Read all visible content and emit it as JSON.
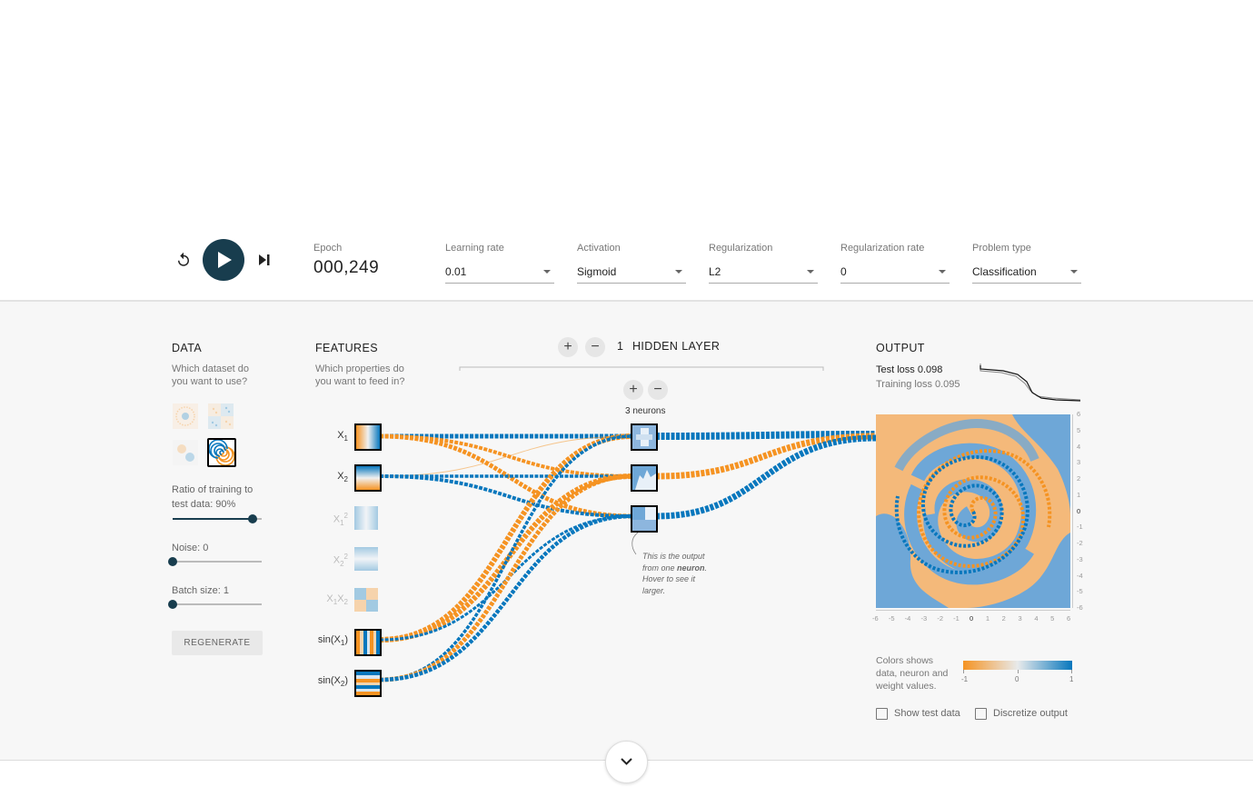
{
  "controls": {
    "reset_icon": "reset-icon",
    "play_icon": "play-icon",
    "step_icon": "step-icon",
    "epoch_label": "Epoch",
    "epoch_value": "000,249",
    "learning_rate": {
      "label": "Learning rate",
      "value": "0.01"
    },
    "activation": {
      "label": "Activation",
      "value": "Sigmoid"
    },
    "regularization": {
      "label": "Regularization",
      "value": "L2"
    },
    "regularization_rate": {
      "label": "Regularization rate",
      "value": "0"
    },
    "problem_type": {
      "label": "Problem type",
      "value": "Classification"
    }
  },
  "data_panel": {
    "heading": "DATA",
    "subtitle_l1": "Which dataset do",
    "subtitle_l2": "you want to use?",
    "ratio_label_l1": "Ratio of training to",
    "ratio_label_l2": "test data:  90%",
    "ratio_value": 0.9,
    "noise_label": "Noise:  0",
    "noise_value": 0,
    "batch_label": "Batch size:  1",
    "batch_value": 0,
    "regenerate": "REGENERATE",
    "selected_dataset": "spiral"
  },
  "features_panel": {
    "heading": "FEATURES",
    "subtitle_l1": "Which properties do",
    "subtitle_l2": "you want to feed in?",
    "features": [
      {
        "base": "X",
        "sub": "1",
        "sup": "",
        "active": true
      },
      {
        "base": "X",
        "sub": "2",
        "sup": "",
        "active": true
      },
      {
        "base": "X",
        "sub": "1",
        "sup": "2",
        "active": false
      },
      {
        "base": "X",
        "sub": "2",
        "sup": "2",
        "active": false
      },
      {
        "base": "X",
        "sub": "1",
        "sup": "",
        "base2": "X",
        "sub2": "2",
        "active": false
      },
      {
        "base": "sin(X",
        "sub": "1",
        "sup": "",
        "tail": ")",
        "active": true
      },
      {
        "base": "sin(X",
        "sub": "2",
        "sup": "",
        "tail": ")",
        "active": true
      }
    ]
  },
  "hidden": {
    "add_layer": "+",
    "remove_layer": "−",
    "layer_count": "1",
    "layer_label": "HIDDEN LAYER",
    "add_neuron": "+",
    "remove_neuron": "−",
    "neurons_label": "3 neurons",
    "callout_l1": "This is the output",
    "callout_l2a": "from one ",
    "callout_l2b": "neuron",
    "callout_l2c": ".",
    "callout_l3": "Hover to see it",
    "callout_l4": "larger."
  },
  "output_panel": {
    "heading": "OUTPUT",
    "test_loss": "Test loss 0.098",
    "training_loss": "Training loss 0.095",
    "y_ticks": [
      "6",
      "5",
      "4",
      "3",
      "2",
      "1",
      "0",
      "-1",
      "-2",
      "-3",
      "-4",
      "-5",
      "-6"
    ],
    "x_ticks": [
      "-6",
      "-5",
      "-4",
      "-3",
      "-2",
      "-1",
      "0",
      "1",
      "2",
      "3",
      "4",
      "5",
      "6"
    ],
    "legend_l1": "Colors shows",
    "legend_l2": "data, neuron and",
    "legend_l3": "weight values.",
    "legend_min": "-1",
    "legend_mid": "0",
    "legend_max": "1",
    "show_test_data": "Show test data",
    "discretize_output": "Discretize output"
  },
  "colors": {
    "orange": "#f59322",
    "blue": "#0877bd",
    "dark": "#183d4e",
    "bg_orange": "#f4b97a",
    "bg_blue": "#6ea7d7"
  }
}
